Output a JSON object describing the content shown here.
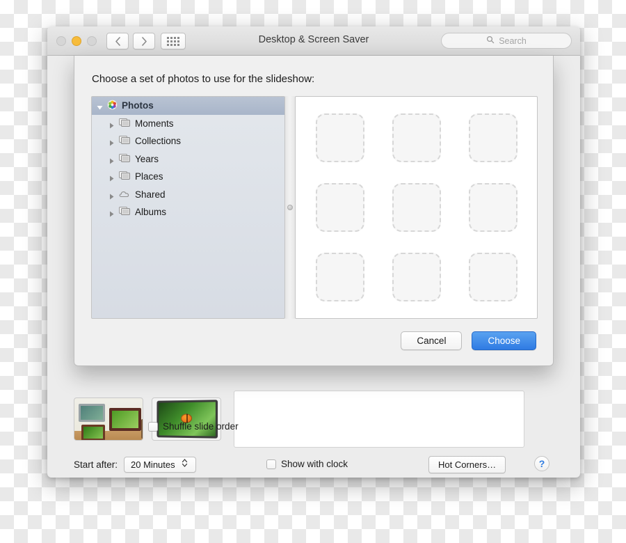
{
  "window": {
    "title": "Desktop & Screen Saver",
    "traffic_lights": [
      {
        "name": "close",
        "color": "#d6d6d6",
        "enabled": false
      },
      {
        "name": "minimize",
        "color": "#f7bc3c",
        "enabled": true
      },
      {
        "name": "zoom",
        "color": "#d6d6d6",
        "enabled": false
      }
    ],
    "nav": {
      "back_icon": "chevron-left",
      "forward_icon": "chevron-right",
      "show_all_icon": "grid-icon"
    },
    "search": {
      "placeholder": "Search",
      "value": "",
      "icon": "search-icon"
    }
  },
  "sheet": {
    "title": "Choose a set of photos to use for the slideshow:",
    "sidebar": {
      "root": {
        "label": "Photos",
        "icon": "photos-pinwheel-icon",
        "expanded": true,
        "selected": true
      },
      "items": [
        {
          "label": "Moments",
          "icon": "photo-stack-icon",
          "expanded": false
        },
        {
          "label": "Collections",
          "icon": "photo-stack-icon",
          "expanded": false
        },
        {
          "label": "Years",
          "icon": "photo-stack-icon",
          "expanded": false
        },
        {
          "label": "Places",
          "icon": "photo-stack-icon",
          "expanded": false
        },
        {
          "label": "Shared",
          "icon": "cloud-icon",
          "expanded": false
        },
        {
          "label": "Albums",
          "icon": "photo-stack-icon",
          "expanded": false
        }
      ]
    },
    "photo_grid": {
      "rows": 3,
      "columns": 3,
      "placeholders": 9,
      "empty": true
    },
    "buttons": {
      "cancel": "Cancel",
      "choose": "Choose",
      "default_color": "#2f7be3"
    }
  },
  "background_pane": {
    "screensaver_thumbnails": [
      {
        "name": "classic-frames-preview"
      },
      {
        "name": "shifting-tiles-monitor-preview"
      }
    ],
    "shuffle_label": "Shuffle slide order",
    "shuffle_checked": false
  },
  "bottom_bar": {
    "start_after_label": "Start after:",
    "start_after_value": "20 Minutes",
    "show_clock_label": "Show with clock",
    "show_clock_checked": false,
    "hot_corners_label": "Hot Corners…",
    "help_label": "?"
  }
}
